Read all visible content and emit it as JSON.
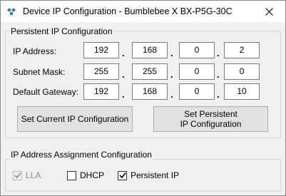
{
  "window": {
    "title": "Device IP Configuration - Bumblebee X BX-P5G-30C",
    "close_icon": "close-icon"
  },
  "persistent_group": {
    "label": "Persistent IP Configuration",
    "rows": [
      {
        "label": "IP Address:",
        "octets": [
          "192",
          "168",
          "0",
          "2"
        ]
      },
      {
        "label": "Subnet Mask:",
        "octets": [
          "255",
          "255",
          "0",
          "0"
        ]
      },
      {
        "label": "Default Gateway:",
        "octets": [
          "192",
          "168",
          "0",
          "10"
        ]
      }
    ],
    "separator": ".",
    "set_current_button": "Set Current IP Configuration",
    "set_persistent_button_line1": "Set Persistent",
    "set_persistent_button_line2": "IP Configuration"
  },
  "assignment_group": {
    "label": "IP Address Assignment Configuration",
    "options": [
      {
        "label": "LLA",
        "checked": true,
        "enabled": false
      },
      {
        "label": "DHCP",
        "checked": false,
        "enabled": true
      },
      {
        "label": "Persistent IP",
        "checked": true,
        "enabled": true
      }
    ]
  }
}
